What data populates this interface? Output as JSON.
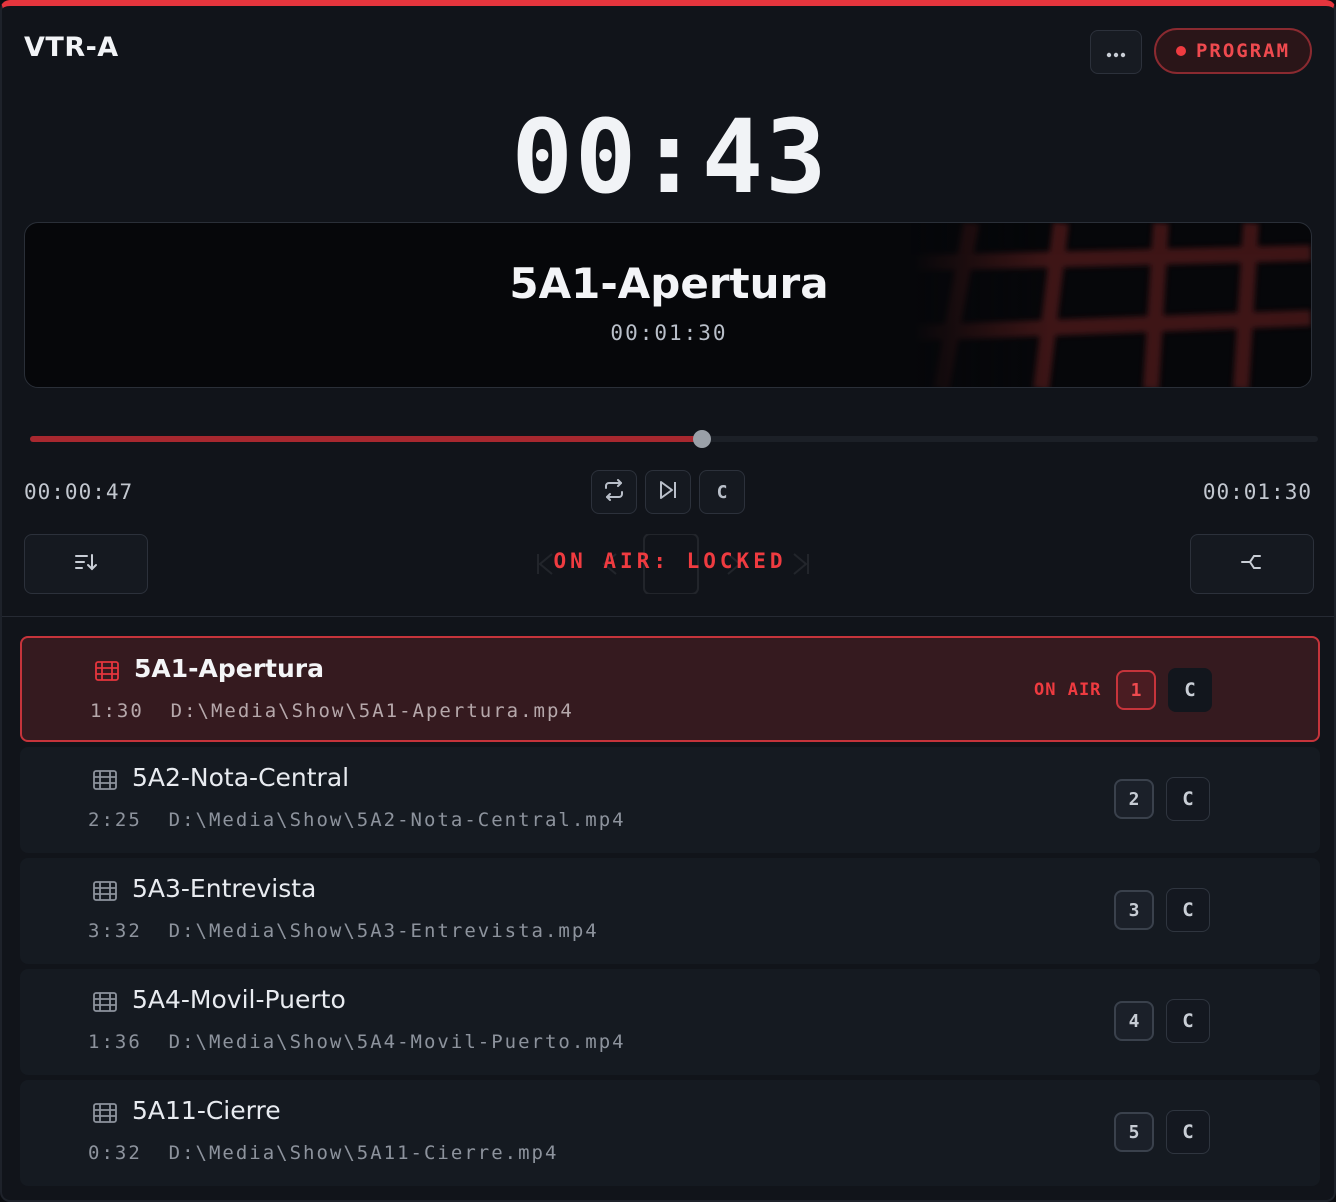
{
  "header": {
    "title": "VTR-A",
    "more_icon": "ellipsis-icon",
    "program_label": "PROGRAM"
  },
  "clock": "00:43",
  "preview": {
    "title": "5A1-Apertura",
    "duration": "00:01:30"
  },
  "playback": {
    "elapsed": "00:00:47",
    "total": "00:01:30",
    "progress_fraction": 0.522,
    "c_label": "C",
    "status_text": "ON AIR: LOCKED"
  },
  "playlist": [
    {
      "name": "5A1-Apertura",
      "duration": "1:30",
      "path": "D:\\Media\\Show\\5A1-Apertura.mp4",
      "number": "1",
      "c_label": "C",
      "onair": "ON AIR",
      "active": true
    },
    {
      "name": "5A2-Nota-Central",
      "duration": "2:25",
      "path": "D:\\Media\\Show\\5A2-Nota-Central.mp4",
      "number": "2",
      "c_label": "C",
      "active": false
    },
    {
      "name": "5A3-Entrevista",
      "duration": "3:32",
      "path": "D:\\Media\\Show\\5A3-Entrevista.mp4",
      "number": "3",
      "c_label": "C",
      "active": false
    },
    {
      "name": "5A4-Movil-Puerto",
      "duration": "1:36",
      "path": "D:\\Media\\Show\\5A4-Movil-Puerto.mp4",
      "number": "4",
      "c_label": "C",
      "active": false
    },
    {
      "name": "5A11-Cierre",
      "duration": "0:32",
      "path": "D:\\Media\\Show\\5A11-Cierre.mp4",
      "number": "5",
      "c_label": "C",
      "active": false
    }
  ],
  "colors": {
    "accent": "#e5353d",
    "panel_bg": "#11141a",
    "active_row_bg": "#351a1f"
  }
}
